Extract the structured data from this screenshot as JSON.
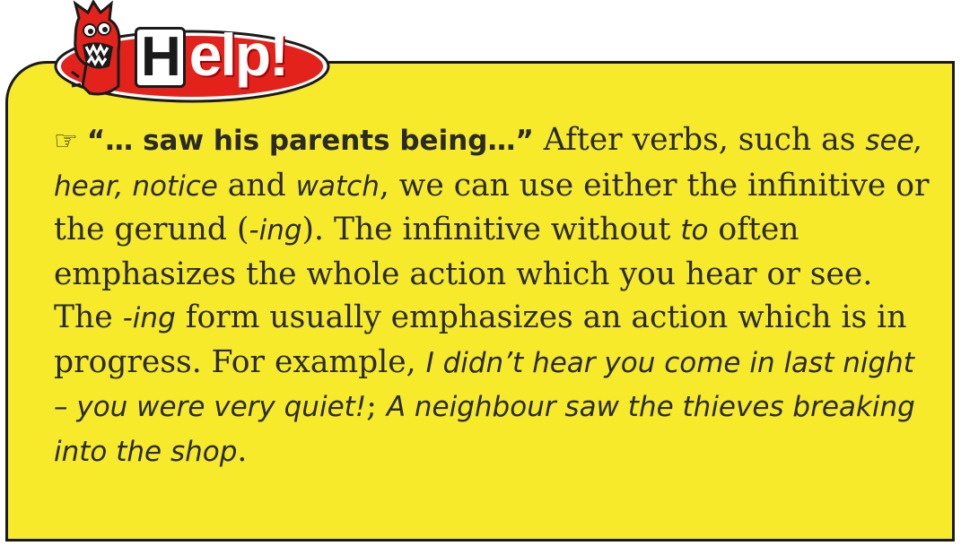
{
  "badge": {
    "h": "H",
    "rest": "elp!"
  },
  "icons": {
    "mascot": "red-monster-mascot-icon",
    "pointer": "pointing-hand-icon"
  },
  "colors": {
    "box_bg": "#f6ea2a",
    "badge_red": "#e3231b",
    "border": "#1a1a1a"
  },
  "body": {
    "pointer_glyph": "☞",
    "quote": "“… saw his parents being…”",
    "p1_a": " After verbs, such as ",
    "see": "see",
    "comma1": ", ",
    "hear": "hear",
    "comma2": ", ",
    "notice": "notice",
    "and": " and ",
    "watch": "watch",
    "p1_b": ", we can use either the infinitive or the gerund (",
    "ing1": "-ing",
    "p1_c": "). The infinitive without ",
    "to": "to",
    "p1_d": " often emphasizes the whole action which you hear or see.",
    "p2_a": "The ",
    "ing2": "-ing",
    "p2_b": " form usually emphasizes an action which is in progress. For example, ",
    "ex1": "I didn’t hear you come in last night – you were very quiet!",
    "semi": "; ",
    "ex2": "A neighbour saw the thieves breaking into the shop",
    "period": "."
  }
}
